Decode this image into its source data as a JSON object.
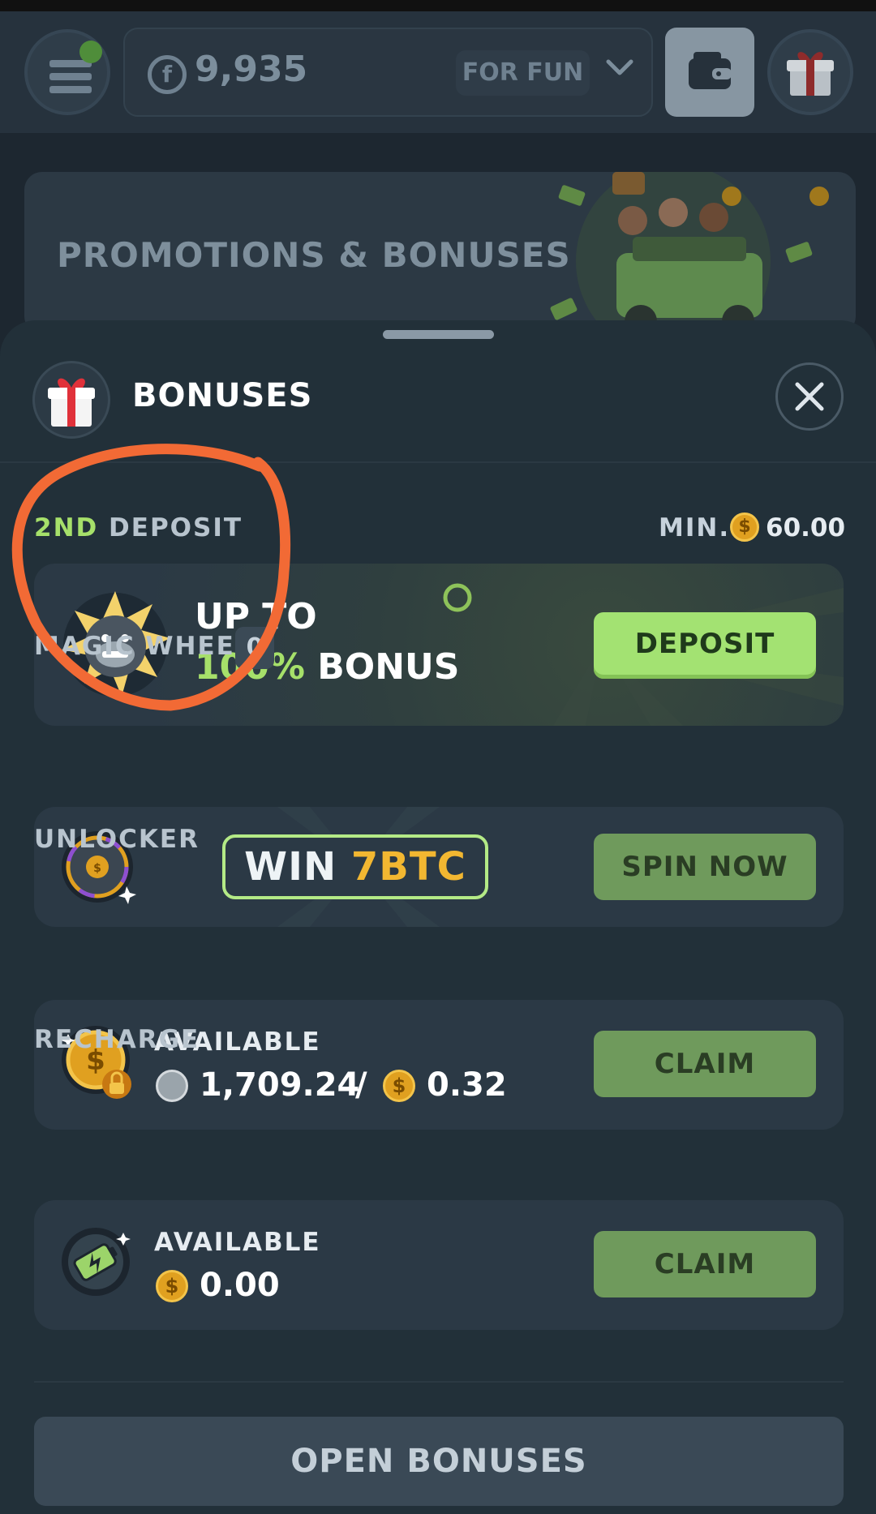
{
  "header": {
    "balance": "9,935",
    "mode": "FOR FUN"
  },
  "promo": {
    "title": "PROMOTIONS & BONUSES"
  },
  "sheet": {
    "title": "BONUSES"
  },
  "deposit": {
    "label_accent": "2ND",
    "label_rest": " DEPOSIT",
    "min_label": "MIN.",
    "min_value": "60.00",
    "line1": "UP TO",
    "percent": "100%",
    "bonus_word": " BONUS",
    "button": "DEPOSIT"
  },
  "magic_wheel": {
    "label": "MAGIC WHEEL",
    "count": "0",
    "win_word": "WIN ",
    "win_amount": "7BTC",
    "button": "SPIN NOW"
  },
  "unlocker": {
    "label": "UNLOCKER",
    "available": "AVAILABLE",
    "locked_amount": "1,709.24",
    "separator": "/",
    "coin_amount": "0.32",
    "button": "CLAIM"
  },
  "recharge": {
    "label": "RECHARGE",
    "available": "AVAILABLE",
    "amount": "0.00",
    "button": "CLAIM"
  },
  "footer": {
    "open_button": "OPEN BONUSES"
  },
  "colors": {
    "accent_green": "#a6e06a",
    "button_green": "#a3e272",
    "gold": "#f2b731",
    "annotation_orange": "#f26a35"
  }
}
